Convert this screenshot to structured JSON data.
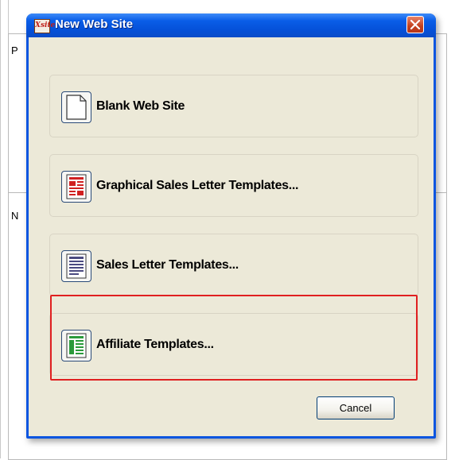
{
  "background": {
    "letter_top": "P",
    "letter_mid": "N"
  },
  "dialog": {
    "title": "New Web Site",
    "app_icon_text": "Xsite",
    "options": [
      {
        "label": "Blank Web Site",
        "icon": "blank-page-icon"
      },
      {
        "label": "Graphical Sales Letter Templates...",
        "icon": "graphical-template-icon"
      },
      {
        "label": "Sales Letter Templates...",
        "icon": "sales-letter-icon"
      },
      {
        "label": "Affiliate Templates...",
        "icon": "affiliate-template-icon"
      }
    ],
    "cancel_label": "Cancel",
    "highlighted_option": "Affiliate Templates..."
  },
  "colors": {
    "titlebar": "#0a55e0",
    "client": "#ece9d8",
    "highlight": "#e02020",
    "graphical_icon": "#d02020",
    "sales_icon": "#4a4a80",
    "affiliate_icon": "#2a9a3a"
  }
}
